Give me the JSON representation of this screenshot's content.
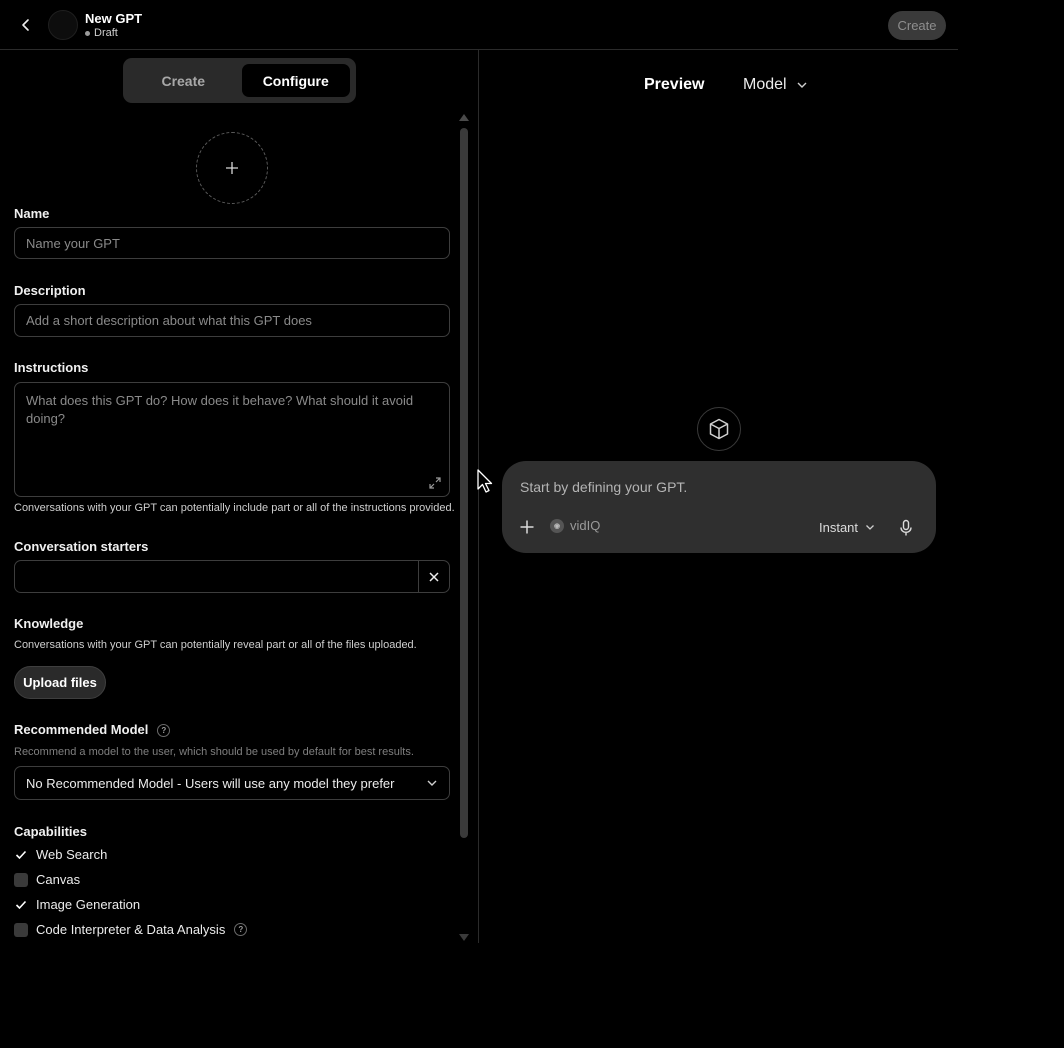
{
  "header": {
    "title": "New GPT",
    "status": "Draft",
    "create_label": "Create"
  },
  "tabs": {
    "create": "Create",
    "configure": "Configure",
    "active": "Configure"
  },
  "form": {
    "name": {
      "label": "Name",
      "placeholder": "Name your GPT",
      "value": ""
    },
    "description": {
      "label": "Description",
      "placeholder": "Add a short description about what this GPT does",
      "value": ""
    },
    "instructions": {
      "label": "Instructions",
      "placeholder": "What does this GPT do? How does it behave? What should it avoid doing?",
      "hint": "Conversations with your GPT can potentially include part or all of the instructions provided.",
      "value": ""
    },
    "conversation_starters": {
      "label": "Conversation starters",
      "value": ""
    },
    "knowledge": {
      "label": "Knowledge",
      "hint": "Conversations with your GPT can potentially reveal part or all of the files uploaded.",
      "upload_label": "Upload files"
    },
    "recommended_model": {
      "label": "Recommended Model",
      "hint": "Recommend a model to the user, which should be used by default for best results.",
      "selected": "No Recommended Model - Users will use any model they prefer"
    },
    "capabilities": {
      "label": "Capabilities",
      "items": [
        {
          "label": "Web Search",
          "checked": true
        },
        {
          "label": "Canvas",
          "checked": false
        },
        {
          "label": "Image Generation",
          "checked": true
        },
        {
          "label": "Code Interpreter & Data Analysis",
          "checked": false
        }
      ]
    }
  },
  "preview": {
    "title": "Preview",
    "model_label": "Model",
    "composer_placeholder": "Start by defining your GPT.",
    "tool_label": "vidIQ",
    "speed_label": "Instant"
  },
  "icons": {
    "back": "chevron-left-icon",
    "avatar_upload": "plus-icon",
    "expand": "expand-icon",
    "remove": "close-icon",
    "help": "question-icon",
    "dropdown": "chevron-down-icon",
    "check": "check-icon",
    "gpt": "cube-icon",
    "attach": "plus-icon",
    "mic": "microphone-icon"
  },
  "colors": {
    "background": "#000000",
    "composer_bg": "#2f2f2f",
    "segment_bg": "#2a2a2a",
    "border": "#3d3d3d"
  }
}
